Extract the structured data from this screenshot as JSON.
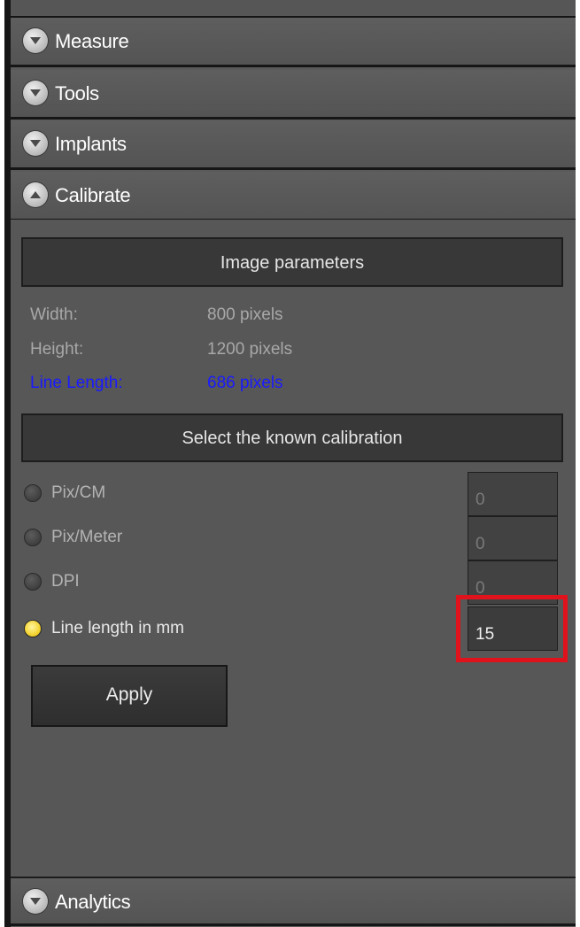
{
  "sections": {
    "measure": {
      "label": "Measure",
      "icon": "chevron-down-icon"
    },
    "tools": {
      "label": "Tools",
      "icon": "chevron-down-icon"
    },
    "implants": {
      "label": "Implants",
      "icon": "chevron-down-icon"
    },
    "calibrate": {
      "label": "Calibrate",
      "icon": "chevron-up-icon"
    },
    "analytics": {
      "label": "Analytics",
      "icon": "chevron-down-icon"
    }
  },
  "calibrate": {
    "image_parameters_title": "Image parameters",
    "params": [
      {
        "label": "Width:",
        "value": "800 pixels"
      },
      {
        "label": "Height:",
        "value": "1200 pixels"
      },
      {
        "label": "Line Length:",
        "value": "686 pixels"
      }
    ],
    "select_title": "Select the known calibration",
    "options": [
      {
        "label": "Pix/CM",
        "value": "0",
        "selected": false
      },
      {
        "label": "Pix/Meter",
        "value": "0",
        "selected": false
      },
      {
        "label": "DPI",
        "value": "0",
        "selected": false
      },
      {
        "label": "Line length in mm",
        "value": "15",
        "selected": true
      }
    ],
    "apply_label": "Apply"
  },
  "colors": {
    "panel_bg": "#575757",
    "highlight_red": "#e0121c",
    "line_length_blue": "#1a1aff",
    "radio_selected": "#f5d431"
  }
}
